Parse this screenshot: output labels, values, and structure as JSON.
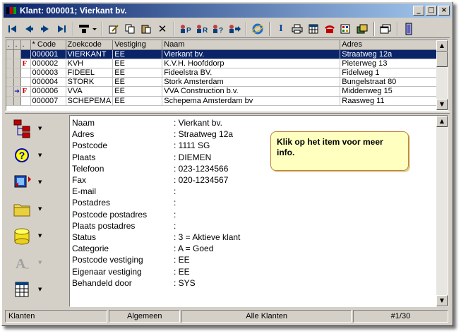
{
  "window": {
    "title": "Klant: 000001; Vierkant bv.",
    "controls": [
      "minimize-icon",
      "maximize-icon",
      "close-icon"
    ]
  },
  "toolbar": {
    "buttons": [
      "first-record-icon",
      "previous-record-icon",
      "next-record-icon",
      "last-record-icon",
      "view-menu-icon",
      "edit-icon",
      "copy-icon",
      "paste-icon",
      "delete-icon",
      "person-p-icon",
      "person-r-icon",
      "person-query-icon",
      "person-forward-icon",
      "internet-explorer-icon",
      "info-icon",
      "print-icon",
      "calendar-icon",
      "phone-icon",
      "report-icon",
      "cards-icon",
      "window-icon",
      "exit-icon"
    ]
  },
  "grid": {
    "columns": [
      ".",
      ".",
      ".",
      "* Code",
      "Zoekcode",
      "Vestiging",
      "Naam",
      "Adres"
    ],
    "rows": [
      {
        "code": "000001",
        "zoekcode": "VIERKANT",
        "vestiging": "EE",
        "naam": "Vierkant bv.",
        "adres": "Straatweg 12a",
        "flag": "",
        "pointer": "",
        "selected": true
      },
      {
        "code": "000002",
        "zoekcode": "KVH",
        "vestiging": "EE",
        "naam": "K.V.H. Hoofddorp",
        "adres": "Pieterweg 13",
        "flag": "F",
        "pointer": "",
        "selected": false
      },
      {
        "code": "000003",
        "zoekcode": "FIDEEL",
        "vestiging": "EE",
        "naam": "Fideelstra BV.",
        "adres": "Fidelweg 1",
        "flag": "",
        "pointer": "",
        "selected": false
      },
      {
        "code": "000004",
        "zoekcode": "STORK",
        "vestiging": "EE",
        "naam": "Stork Amsterdam",
        "adres": "Bungelstraat 80",
        "flag": "",
        "pointer": "",
        "selected": false
      },
      {
        "code": "000006",
        "zoekcode": "VVA",
        "vestiging": "EE",
        "naam": "VVA Construction b.v.",
        "adres": "Middenweg 15",
        "flag": "F",
        "pointer": "arrow-right-icon",
        "selected": false
      },
      {
        "code": "000007",
        "zoekcode": "SCHEPEMA",
        "vestiging": "EE",
        "naam": "Schepema Amsterdam bv",
        "adres": "Raasweg 11",
        "flag": "",
        "pointer": "",
        "selected": false
      }
    ]
  },
  "sidebar": {
    "buttons": [
      {
        "name": "hierarchy-icon"
      },
      {
        "name": "help-icon"
      },
      {
        "name": "transfer-icon"
      },
      {
        "name": "folder-icon"
      },
      {
        "name": "database-icon"
      },
      {
        "name": "font-icon"
      },
      {
        "name": "table-icon"
      }
    ]
  },
  "detail": {
    "fields": [
      {
        "label": "Naam",
        "value": ": Vierkant bv."
      },
      {
        "label": "Adres",
        "value": ": Straatweg 12a"
      },
      {
        "label": "Postcode",
        "value": ": 1111 SG"
      },
      {
        "label": "Plaats",
        "value": ": DIEMEN"
      },
      {
        "label": "Telefoon",
        "value": ": 023-1234566"
      },
      {
        "label": "Fax",
        "value": ": 020-1234567"
      },
      {
        "label": "E-mail",
        "value": ":"
      },
      {
        "label": "Postadres",
        "value": ":"
      },
      {
        "label": "Postcode postadres",
        "value": ":"
      },
      {
        "label": "Plaats postadres",
        "value": ":"
      },
      {
        "label": "Status",
        "value": ": 3 = Aktieve klant"
      },
      {
        "label": "Categorie",
        "value": ": A = Goed"
      },
      {
        "label": "Postcode vestiging",
        "value": ": EE"
      },
      {
        "label": "Eigenaar vestiging",
        "value": ": EE"
      },
      {
        "label": "Behandeld door",
        "value": ": SYS"
      }
    ],
    "callout": "Klik op het item voor meer info."
  },
  "statusbar": {
    "panels": [
      "Klanten",
      "Algemeen",
      "Alle Klanten",
      "#1/30"
    ]
  },
  "colors": {
    "selection": "#0a246a",
    "callout_bg": "#ffffc0",
    "flag_red": "#cc0000",
    "face": "#d4d0c8"
  }
}
